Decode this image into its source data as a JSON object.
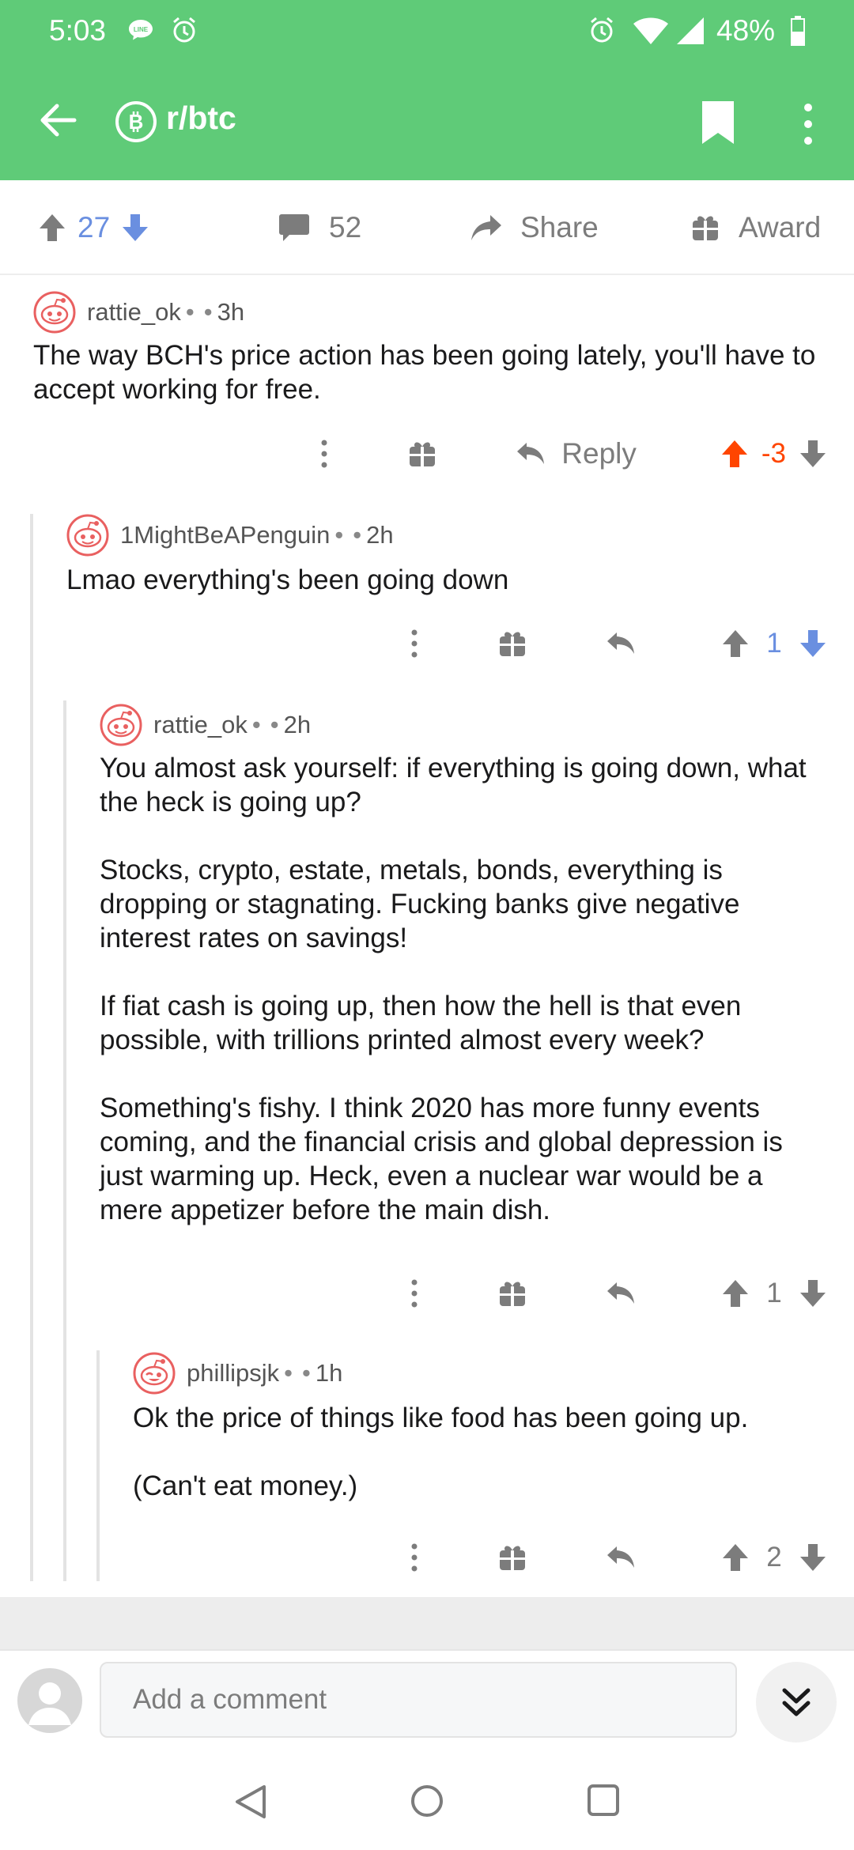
{
  "status_bar": {
    "time": "5:03",
    "battery": "48%"
  },
  "header": {
    "subreddit": "r/btc",
    "color": "#5fcb78"
  },
  "post_bar": {
    "score": "27",
    "comments": "52",
    "share_label": "Share",
    "award_label": "Award"
  },
  "comments": [
    {
      "author": "rattie_ok",
      "age": "3h",
      "paragraphs": [
        "The way BCH's price action has been going lately, you'll have to accept working for free."
      ],
      "reply_label": "Reply",
      "score": "-3",
      "vote_state": "upvoted"
    },
    {
      "author": "1MightBeAPenguin",
      "age": "2h",
      "paragraphs": [
        "Lmao everything's been going down"
      ],
      "score": "1",
      "vote_state": "downvoted"
    },
    {
      "author": "rattie_ok",
      "age": "2h",
      "paragraphs": [
        "You almost ask yourself: if everything is going down, what the heck is going up?",
        "Stocks, crypto, estate, metals, bonds, everything is dropping or stagnating. Fucking banks give negative interest rates on savings!",
        "If fiat cash is going up, then how the hell is that even possible, with trillions printed almost every week?",
        "Something's fishy. I think 2020 has more funny events coming, and the financial crisis and global depression is just warming up. Heck, even a nuclear war would be a mere appetizer before the main dish."
      ],
      "score": "1",
      "vote_state": "none"
    },
    {
      "author": "phillipsjk",
      "age": "1h",
      "paragraphs": [
        "Ok the price of things like food has been going up.",
        "(Can't eat money.)"
      ],
      "score": "2",
      "vote_state": "none"
    }
  ],
  "compose": {
    "placeholder": "Add a comment"
  },
  "colors": {
    "upvote": "#ff4500",
    "downvote": "#6a8fe0",
    "neutral_icon": "#7c7c7c"
  }
}
